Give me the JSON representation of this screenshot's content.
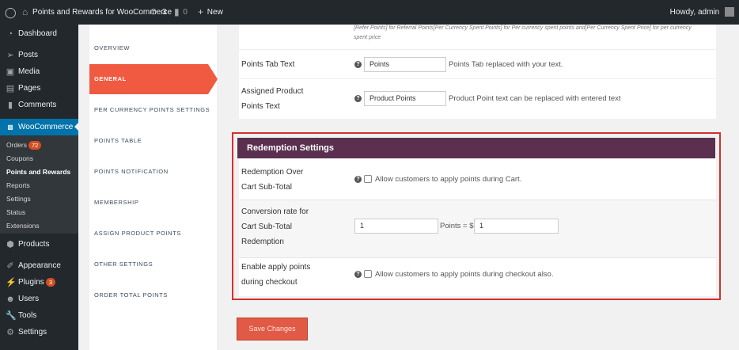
{
  "adminbar": {
    "site_title": "Points and Rewards for WooCommerce",
    "updates_count": "3",
    "comments_count": "0",
    "new_label": "New",
    "howdy": "Howdy, admin"
  },
  "sidebar": {
    "items": [
      {
        "label": "Dashboard",
        "icon": "dashboard-icon"
      },
      {
        "label": "Posts",
        "icon": "pin-icon"
      },
      {
        "label": "Media",
        "icon": "media-icon"
      },
      {
        "label": "Pages",
        "icon": "pages-icon"
      },
      {
        "label": "Comments",
        "icon": "comments-icon"
      },
      {
        "label": "WooCommerce",
        "icon": "woocommerce-icon"
      },
      {
        "label": "Products",
        "icon": "products-icon"
      },
      {
        "label": "Appearance",
        "icon": "appearance-icon"
      },
      {
        "label": "Plugins",
        "icon": "plugins-icon",
        "badge": "3"
      },
      {
        "label": "Users",
        "icon": "users-icon"
      },
      {
        "label": "Tools",
        "icon": "tools-icon"
      },
      {
        "label": "Settings",
        "icon": "settings-icon"
      }
    ],
    "submenu": [
      {
        "label": "Orders",
        "badge": "72"
      },
      {
        "label": "Coupons"
      },
      {
        "label": "Points and Rewards"
      },
      {
        "label": "Reports"
      },
      {
        "label": "Settings"
      },
      {
        "label": "Status"
      },
      {
        "label": "Extensions"
      }
    ]
  },
  "tabs": [
    "OVERVIEW",
    "GENERAL",
    "PER CURRENCY POINTS SETTINGS",
    "POINTS TABLE",
    "POINTS NOTIFICATION",
    "MEMBERSHIP",
    "ASSIGN PRODUCT POINTS",
    "OTHER SETTINGS",
    "ORDER TOTAL POINTS"
  ],
  "active_tab": "GENERAL",
  "top_panel": {
    "shortcode_note_line1": "[Refer Points] for Referral Points[Per Currency Spent Points] for Per currency spent points and[Per Currency Spent Price] for per currency",
    "shortcode_note_line2": "spent price",
    "points_tab": {
      "label": "Points Tab Text",
      "value": "Points",
      "description": "Points Tab replaced with your text."
    },
    "assigned_product": {
      "label_line1": "Assigned Product",
      "label_line2": "Points Text",
      "value": "Product Points",
      "description": "Product Point text can be replaced with entered text"
    }
  },
  "redemption": {
    "header": "Redemption Settings",
    "cart_subtotal": {
      "label_line1": "Redemption Over",
      "label_line2": "Cart Sub-Total",
      "checkbox_label": "Allow customers to apply points during Cart."
    },
    "conversion": {
      "label_line1": "Conversion rate for",
      "label_line2": "Cart Sub-Total",
      "label_line3": "Redemption",
      "points_value": "1",
      "mid_text": "Points = $",
      "dollar_value": "1"
    },
    "checkout": {
      "label_line1": "Enable apply points",
      "label_line2": "during checkout",
      "checkbox_label": "Allow customers to apply points during checkout also."
    }
  },
  "save_button": "Save Changes",
  "colors": {
    "accent": "#f05a40",
    "header": "#5a2f4f",
    "outline": "#d32f2f",
    "wp_blue": "#0073aa",
    "admin_dark": "#23282d"
  }
}
